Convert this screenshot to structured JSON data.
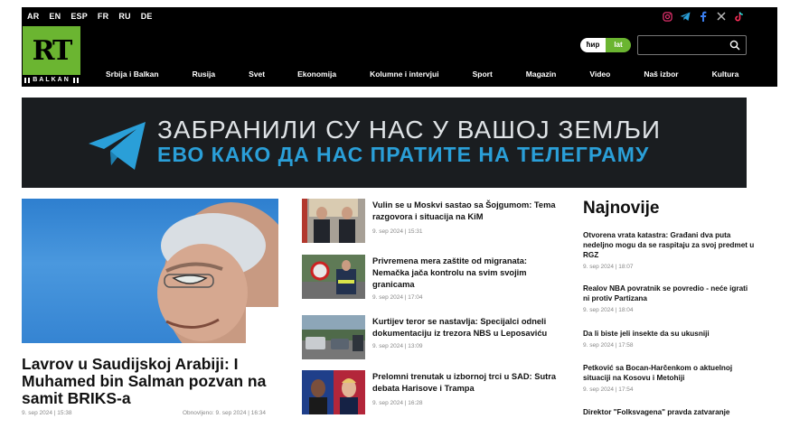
{
  "header": {
    "languages": [
      "AR",
      "EN",
      "ESP",
      "FR",
      "RU",
      "DE"
    ],
    "socials": [
      "instagram-icon",
      "telegram-icon",
      "facebook-icon",
      "x-icon",
      "tiktok-icon"
    ],
    "logo": {
      "mark": "RT",
      "sub": "BALKAN"
    },
    "script_toggle": {
      "cyrillic": "ћир",
      "latin": "lat"
    },
    "search": {
      "placeholder": ""
    },
    "nav": [
      "Srbija i Balkan",
      "Rusija",
      "Svet",
      "Ekonomija",
      "Kolumne i intervjui",
      "Sport",
      "Magazin",
      "Video",
      "Naš izbor",
      "Kultura"
    ]
  },
  "colors": {
    "brand_green": "#6bb531",
    "telegram_blue": "#2a9fd8",
    "header_bg": "#000000"
  },
  "banner": {
    "line1": "ЗАБРАНИЛИ СУ НАС У ВАШОЈ ЗЕМЉИ",
    "line2": "ЕВО КАКО ДА НАС ПРАТИТЕ НА ТЕЛЕГРАМУ"
  },
  "lead": {
    "title": "Lavrov u Saudijskoj Arabiji: I Muhamed bin Salman pozvan na samit BRIKS-a",
    "date": "9. sep 2024 | 15:38",
    "updated": "Obnovljeno: 9. sep 2024 | 16:34"
  },
  "middle": [
    {
      "title": "Vulin se u Moskvi sastao sa Šojgumom: Tema razgovora i situacija na KiM",
      "date": "9. sep 2024 | 15:31"
    },
    {
      "title": "Privremena mera zaštite od migranata: Nemačka jača kontrolu na svim svojim granicama",
      "date": "9. sep 2024 | 17:04"
    },
    {
      "title": "Kurtijev teror se nastavlja: Specijalci odneli dokumentaciju iz trezora NBS u Leposaviću",
      "date": "9. sep 2024 | 13:09"
    },
    {
      "title": "Prelomni trenutak u izbornoj trci u SAD: Sutra debata Harisove i Trampa",
      "date": "9. sep 2024 | 16:28"
    }
  ],
  "latest": {
    "heading": "Najnovije",
    "items": [
      {
        "title": "Otvorena vrata katastra: Građani dva puta nedeljno mogu da se raspitaju za svoj predmet u RGZ",
        "date": "9. sep 2024 | 18:07"
      },
      {
        "title": "Realov NBA povratnik se povredio - neće igrati ni protiv Partizana",
        "date": "9. sep 2024 | 18:04"
      },
      {
        "title": "Da li biste jeli insekte da su ukusniji",
        "date": "9. sep 2024 | 17:58"
      },
      {
        "title": "Petković sa Bocan-Harčenkom o aktuelnoj situaciji na Kosovu i Metohiji",
        "date": "9. sep 2024 | 17:54"
      },
      {
        "title": "Direktor \"Folksvagena\" pravda zatvaranje",
        "date": ""
      }
    ]
  }
}
